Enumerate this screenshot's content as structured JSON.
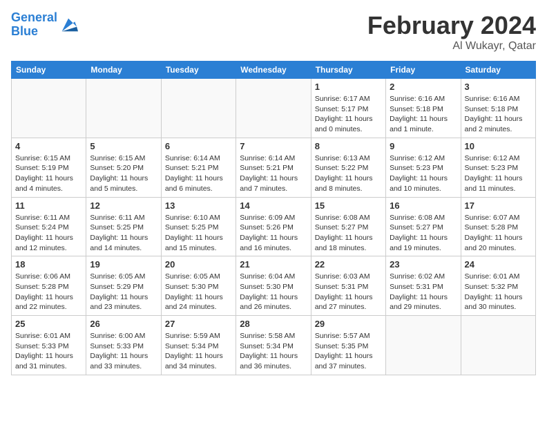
{
  "header": {
    "logo_line1": "General",
    "logo_line2": "Blue",
    "month_title": "February 2024",
    "location": "Al Wukayr, Qatar"
  },
  "weekdays": [
    "Sunday",
    "Monday",
    "Tuesday",
    "Wednesday",
    "Thursday",
    "Friday",
    "Saturday"
  ],
  "weeks": [
    [
      {
        "day": "",
        "info": ""
      },
      {
        "day": "",
        "info": ""
      },
      {
        "day": "",
        "info": ""
      },
      {
        "day": "",
        "info": ""
      },
      {
        "day": "1",
        "info": "Sunrise: 6:17 AM\nSunset: 5:17 PM\nDaylight: 11 hours\nand 0 minutes."
      },
      {
        "day": "2",
        "info": "Sunrise: 6:16 AM\nSunset: 5:18 PM\nDaylight: 11 hours\nand 1 minute."
      },
      {
        "day": "3",
        "info": "Sunrise: 6:16 AM\nSunset: 5:18 PM\nDaylight: 11 hours\nand 2 minutes."
      }
    ],
    [
      {
        "day": "4",
        "info": "Sunrise: 6:15 AM\nSunset: 5:19 PM\nDaylight: 11 hours\nand 4 minutes."
      },
      {
        "day": "5",
        "info": "Sunrise: 6:15 AM\nSunset: 5:20 PM\nDaylight: 11 hours\nand 5 minutes."
      },
      {
        "day": "6",
        "info": "Sunrise: 6:14 AM\nSunset: 5:21 PM\nDaylight: 11 hours\nand 6 minutes."
      },
      {
        "day": "7",
        "info": "Sunrise: 6:14 AM\nSunset: 5:21 PM\nDaylight: 11 hours\nand 7 minutes."
      },
      {
        "day": "8",
        "info": "Sunrise: 6:13 AM\nSunset: 5:22 PM\nDaylight: 11 hours\nand 8 minutes."
      },
      {
        "day": "9",
        "info": "Sunrise: 6:12 AM\nSunset: 5:23 PM\nDaylight: 11 hours\nand 10 minutes."
      },
      {
        "day": "10",
        "info": "Sunrise: 6:12 AM\nSunset: 5:23 PM\nDaylight: 11 hours\nand 11 minutes."
      }
    ],
    [
      {
        "day": "11",
        "info": "Sunrise: 6:11 AM\nSunset: 5:24 PM\nDaylight: 11 hours\nand 12 minutes."
      },
      {
        "day": "12",
        "info": "Sunrise: 6:11 AM\nSunset: 5:25 PM\nDaylight: 11 hours\nand 14 minutes."
      },
      {
        "day": "13",
        "info": "Sunrise: 6:10 AM\nSunset: 5:25 PM\nDaylight: 11 hours\nand 15 minutes."
      },
      {
        "day": "14",
        "info": "Sunrise: 6:09 AM\nSunset: 5:26 PM\nDaylight: 11 hours\nand 16 minutes."
      },
      {
        "day": "15",
        "info": "Sunrise: 6:08 AM\nSunset: 5:27 PM\nDaylight: 11 hours\nand 18 minutes."
      },
      {
        "day": "16",
        "info": "Sunrise: 6:08 AM\nSunset: 5:27 PM\nDaylight: 11 hours\nand 19 minutes."
      },
      {
        "day": "17",
        "info": "Sunrise: 6:07 AM\nSunset: 5:28 PM\nDaylight: 11 hours\nand 20 minutes."
      }
    ],
    [
      {
        "day": "18",
        "info": "Sunrise: 6:06 AM\nSunset: 5:28 PM\nDaylight: 11 hours\nand 22 minutes."
      },
      {
        "day": "19",
        "info": "Sunrise: 6:05 AM\nSunset: 5:29 PM\nDaylight: 11 hours\nand 23 minutes."
      },
      {
        "day": "20",
        "info": "Sunrise: 6:05 AM\nSunset: 5:30 PM\nDaylight: 11 hours\nand 24 minutes."
      },
      {
        "day": "21",
        "info": "Sunrise: 6:04 AM\nSunset: 5:30 PM\nDaylight: 11 hours\nand 26 minutes."
      },
      {
        "day": "22",
        "info": "Sunrise: 6:03 AM\nSunset: 5:31 PM\nDaylight: 11 hours\nand 27 minutes."
      },
      {
        "day": "23",
        "info": "Sunrise: 6:02 AM\nSunset: 5:31 PM\nDaylight: 11 hours\nand 29 minutes."
      },
      {
        "day": "24",
        "info": "Sunrise: 6:01 AM\nSunset: 5:32 PM\nDaylight: 11 hours\nand 30 minutes."
      }
    ],
    [
      {
        "day": "25",
        "info": "Sunrise: 6:01 AM\nSunset: 5:33 PM\nDaylight: 11 hours\nand 31 minutes."
      },
      {
        "day": "26",
        "info": "Sunrise: 6:00 AM\nSunset: 5:33 PM\nDaylight: 11 hours\nand 33 minutes."
      },
      {
        "day": "27",
        "info": "Sunrise: 5:59 AM\nSunset: 5:34 PM\nDaylight: 11 hours\nand 34 minutes."
      },
      {
        "day": "28",
        "info": "Sunrise: 5:58 AM\nSunset: 5:34 PM\nDaylight: 11 hours\nand 36 minutes."
      },
      {
        "day": "29",
        "info": "Sunrise: 5:57 AM\nSunset: 5:35 PM\nDaylight: 11 hours\nand 37 minutes."
      },
      {
        "day": "",
        "info": ""
      },
      {
        "day": "",
        "info": ""
      }
    ]
  ]
}
